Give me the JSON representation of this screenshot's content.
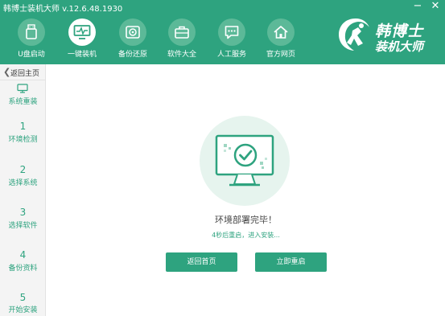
{
  "window": {
    "title": "韩博士装机大师 v.12.6.48.1930",
    "minimize": "−",
    "close": "✕"
  },
  "nav": [
    {
      "label": "U盘启动",
      "icon": "usb-drive-icon"
    },
    {
      "label": "一键装机",
      "icon": "monitor-icon",
      "active": true
    },
    {
      "label": "备份还原",
      "icon": "backup-restore-icon"
    },
    {
      "label": "软件大全",
      "icon": "toolbox-icon"
    },
    {
      "label": "人工服务",
      "icon": "chat-icon"
    },
    {
      "label": "官方网页",
      "icon": "home-icon"
    }
  ],
  "brand": {
    "name": "韩博士",
    "subtitle": "装机大师"
  },
  "sidebar": {
    "back_label": "返回主页",
    "steps": [
      {
        "number": "",
        "label": "系统重装",
        "icon": "monitor-icon"
      },
      {
        "number": "1",
        "label": "环境检测"
      },
      {
        "number": "2",
        "label": "选择系统"
      },
      {
        "number": "3",
        "label": "选择软件"
      },
      {
        "number": "4",
        "label": "备份资料"
      },
      {
        "number": "5",
        "label": "开始安装"
      }
    ]
  },
  "main": {
    "title": "环境部署完毕！",
    "subtitle": "4秒后重启，进入安装...",
    "buttons": {
      "home": "返回首页",
      "restart": "立即重启"
    }
  },
  "colors": {
    "accent": "#2ea37f",
    "accent_light": "#5cb998",
    "illustration_bg": "#e6f4ee"
  }
}
